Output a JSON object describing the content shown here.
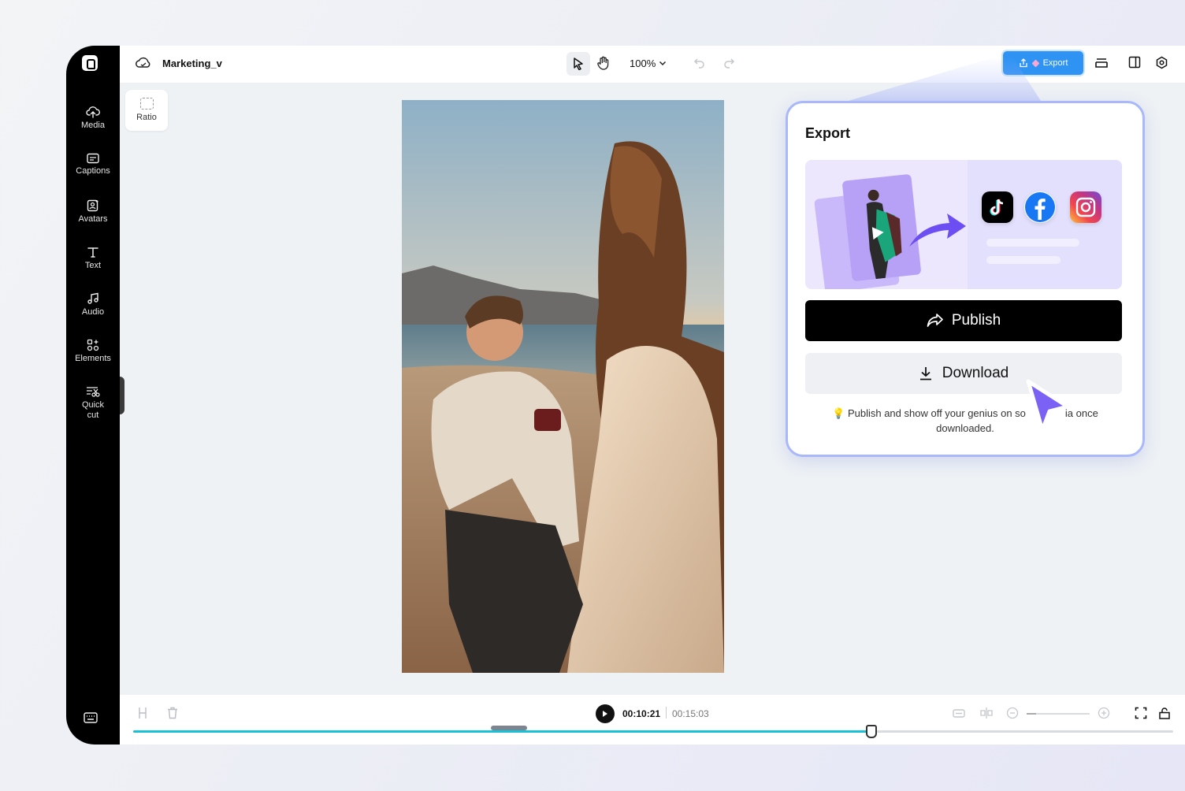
{
  "project": {
    "name": "Marketing_v"
  },
  "toolbar": {
    "zoom": "100%",
    "export_label": "Export",
    "colors": {
      "export_bg": "#2f93f3"
    }
  },
  "sidebar": {
    "items": [
      {
        "label": "Media",
        "icon": "cloud-upload-icon"
      },
      {
        "label": "Captions",
        "icon": "captions-icon"
      },
      {
        "label": "Avatars",
        "icon": "avatar-icon"
      },
      {
        "label": "Text",
        "icon": "text-icon"
      },
      {
        "label": "Audio",
        "icon": "music-icon"
      },
      {
        "label": "Elements",
        "icon": "elements-icon"
      },
      {
        "label": "Quick\ncut",
        "icon": "quick-cut-icon"
      }
    ]
  },
  "canvas": {
    "ratio_label": "Ratio"
  },
  "playback": {
    "current_time": "00:10:21",
    "total_time": "00:15:03",
    "progress": 0.71
  },
  "export_panel": {
    "title": "Export",
    "publish_label": "Publish",
    "download_label": "Download",
    "note": "Publish and show off your genius on so",
    "note_tail": "ia once downloaded.",
    "social_icons": [
      "tiktok-icon",
      "facebook-icon",
      "instagram-icon"
    ]
  }
}
